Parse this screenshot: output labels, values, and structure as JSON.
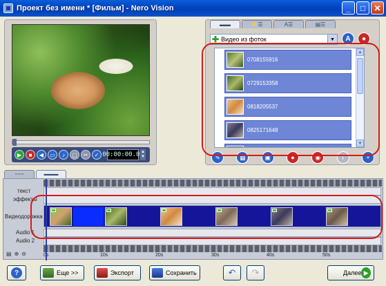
{
  "window": {
    "title": "Проект без имени * [Фильм] - Nero Vision",
    "minimize": "_",
    "maximize": "□",
    "close": "✕"
  },
  "player": {
    "timecode": "00:00:00.00"
  },
  "content": {
    "dropdown_value": "Видео из фоток",
    "items": [
      {
        "label": "0708155916"
      },
      {
        "label": "0729153358"
      },
      {
        "label": "0818205537"
      },
      {
        "label": "0825171648"
      }
    ]
  },
  "timeline": {
    "tracks": {
      "text": "текст",
      "effects": "эффекты",
      "video": "Видеодорожка",
      "audio1": "Audio 1",
      "audio2": "Audio 2"
    },
    "ruler": [
      "0s",
      "10s",
      "20s",
      "30s",
      "40s",
      "50s"
    ]
  },
  "bottom": {
    "more": "Еще >>",
    "export": "Экспорт",
    "save": "Сохранить",
    "next": "Далее"
  },
  "colors": {
    "highlight": "#d61a1a",
    "video_track": "#15159a",
    "selected_item": "#6f86d6"
  }
}
